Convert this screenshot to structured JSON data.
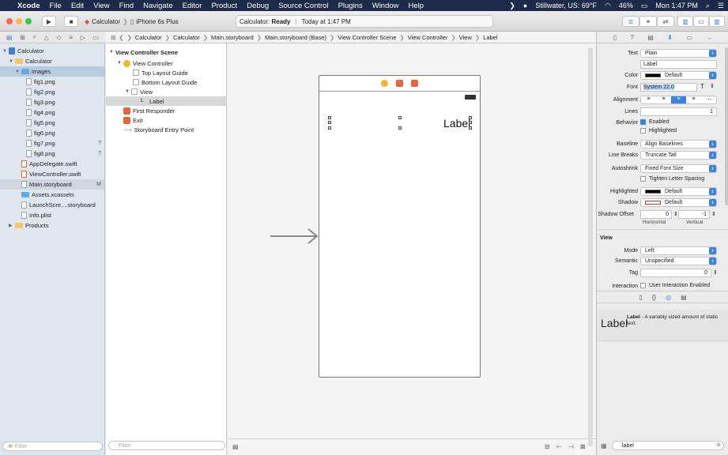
{
  "menubar": {
    "app": "Xcode",
    "items": [
      "File",
      "Edit",
      "View",
      "Find",
      "Navigate",
      "Editor",
      "Product",
      "Debug",
      "Source Control",
      "Plugins",
      "Window",
      "Help"
    ],
    "weather": "Stillwater, US: 69°F",
    "battery": "46%",
    "clock": "Mon 1:47 PM"
  },
  "toolbar": {
    "scheme_target": "Calculator",
    "scheme_device": "iPhone 6s Plus",
    "status_name": "Calculator",
    "status_state": "Ready",
    "status_time": "Today at 1:47 PM"
  },
  "navigator": {
    "project": "Calculator",
    "group": "Calculator",
    "folder": "images",
    "files": [
      {
        "name": "fig1.png",
        "badge": ""
      },
      {
        "name": "fig2.png",
        "badge": ""
      },
      {
        "name": "fig3.png",
        "badge": ""
      },
      {
        "name": "fig4.png",
        "badge": ""
      },
      {
        "name": "fig5.png",
        "badge": ""
      },
      {
        "name": "fig6.png",
        "badge": ""
      },
      {
        "name": "fig7.png",
        "badge": "?"
      },
      {
        "name": "fig8.png",
        "badge": "?"
      }
    ],
    "source_files": [
      {
        "name": "AppDelegate.swift",
        "badge": ""
      },
      {
        "name": "ViewController.swift",
        "badge": ""
      },
      {
        "name": "Main.storyboard",
        "badge": "M"
      },
      {
        "name": "Assets.xcassets",
        "badge": ""
      },
      {
        "name": "LaunchScre....storyboard",
        "badge": ""
      },
      {
        "name": "Info.plist",
        "badge": ""
      }
    ],
    "products": "Products",
    "filter_placeholder": "Filter"
  },
  "jumpbar": [
    "Calculator",
    "Calculator",
    "Main.storyboard",
    "Main.storyboard (Base)",
    "View Controller Scene",
    "View Controller",
    "View",
    "Label"
  ],
  "outline": {
    "scene": "View Controller Scene",
    "controller": "View Controller",
    "top_guide": "Top Layout Guide",
    "bottom_guide": "Bottom Layout Guide",
    "view": "View",
    "label": "Label",
    "first_responder": "First Responder",
    "exit": "Exit",
    "entry": "Storyboard Entry Point",
    "filter_placeholder": "Filter"
  },
  "canvas": {
    "label_text": "Label"
  },
  "inspector": {
    "text_label": "Text",
    "text_value": "Plain",
    "text_content": "Label",
    "color_label": "Color",
    "color_value": "Default",
    "font_label": "Font",
    "font_value": "System 22.0",
    "alignment_label": "Alignment",
    "lines_label": "Lines",
    "lines_value": "1",
    "behavior_label": "Behavior",
    "enabled": "Enabled",
    "highlighted_chk": "Highlighted",
    "baseline_label": "Baseline",
    "baseline_value": "Align Baselines",
    "linebreaks_label": "Line Breaks",
    "linebreaks_value": "Truncate Tail",
    "autoshrink_label": "Autoshrink",
    "autoshrink_value": "Fixed Font Size",
    "tighten": "Tighten Letter Spacing",
    "highlighted_label": "Highlighted",
    "highlighted_value": "Default",
    "shadow_label": "Shadow",
    "shadow_value": "Default",
    "shadow_offset_label": "Shadow Offset",
    "offset_h": "0",
    "offset_v": "-1",
    "horizontal": "Horizontal",
    "vertical": "Vertical",
    "view_section": "View",
    "mode_label": "Mode",
    "mode_value": "Left",
    "semantic_label": "Semantic",
    "semantic_value": "Unspecified",
    "tag_label": "Tag",
    "tag_value": "0",
    "interaction_label": "Interaction",
    "interaction_value": "User Interaction Enabled"
  },
  "library": {
    "item_title": "Label",
    "item_name": "Label",
    "item_desc": " - A variably sized amount of static text.",
    "filter_value": "label"
  }
}
